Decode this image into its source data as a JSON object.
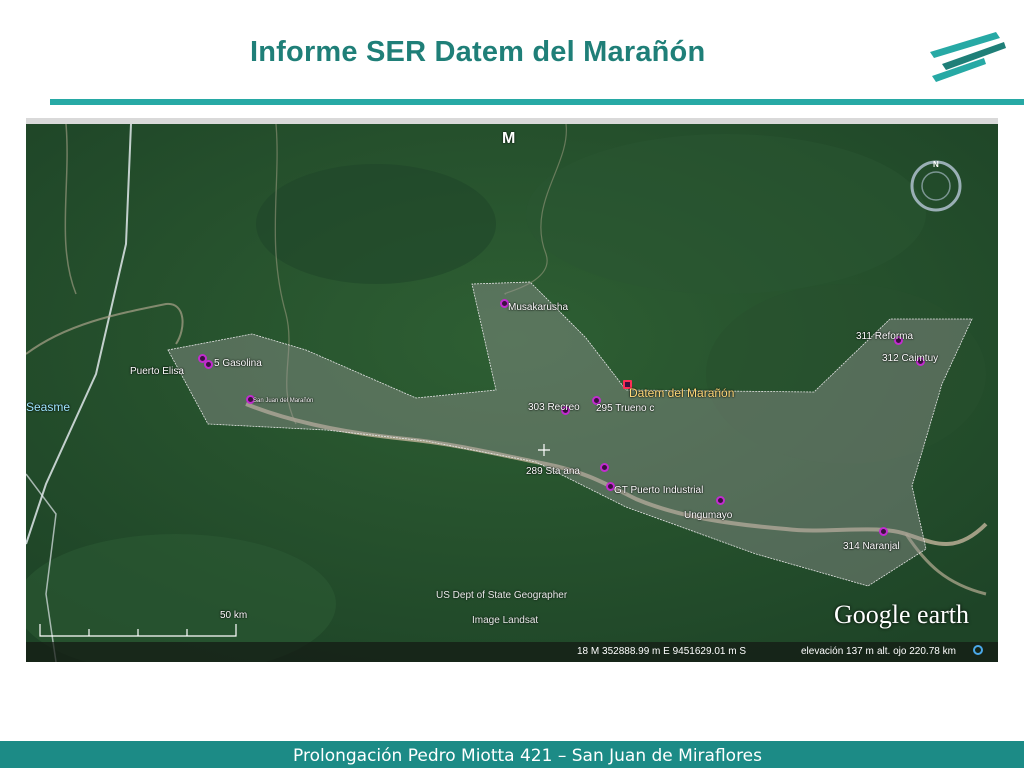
{
  "slide": {
    "title": "Informe SER Datem del Marañón",
    "footer": "Prolongación Pedro Miotta 421 – San Juan de Miraflores"
  },
  "map": {
    "app": "Google earth",
    "colors": {
      "boundary_fill": "rgba(150,150,150,0.42)",
      "marker": "#c22bd0",
      "label": "#ffffff",
      "accent": "#1f7f78"
    },
    "top_marker": "M",
    "places": {
      "musakarusha": "Musakarusha",
      "reforma": "311 Reforma",
      "caimtuy": "312 Caimtuy",
      "gasolina": "5 Gasolina",
      "puerto_elisa": "Puerto Elisa",
      "seasme": "Seasme",
      "datem": "Datem del Marañón",
      "recreo": "303 Recreo",
      "trueno": "295 Trueno c",
      "sta_ana": "289 Sta ana",
      "puerto_industrial": "GT Puerto Industrial",
      "ungumayo": "Ungumayo",
      "naranjal": "314 Naranjal",
      "river_small": "San Juan del Marañón"
    },
    "scale": "50 km",
    "credits": [
      "US Dept of State Geographer",
      "Image Landsat"
    ],
    "status_bar": {
      "coords": "18 M 352888.99 m E 9451629.01 m S",
      "elevation": "elevación    137 m",
      "eye_alt": "alt. ojo 220.78 km"
    },
    "compass": "N"
  }
}
